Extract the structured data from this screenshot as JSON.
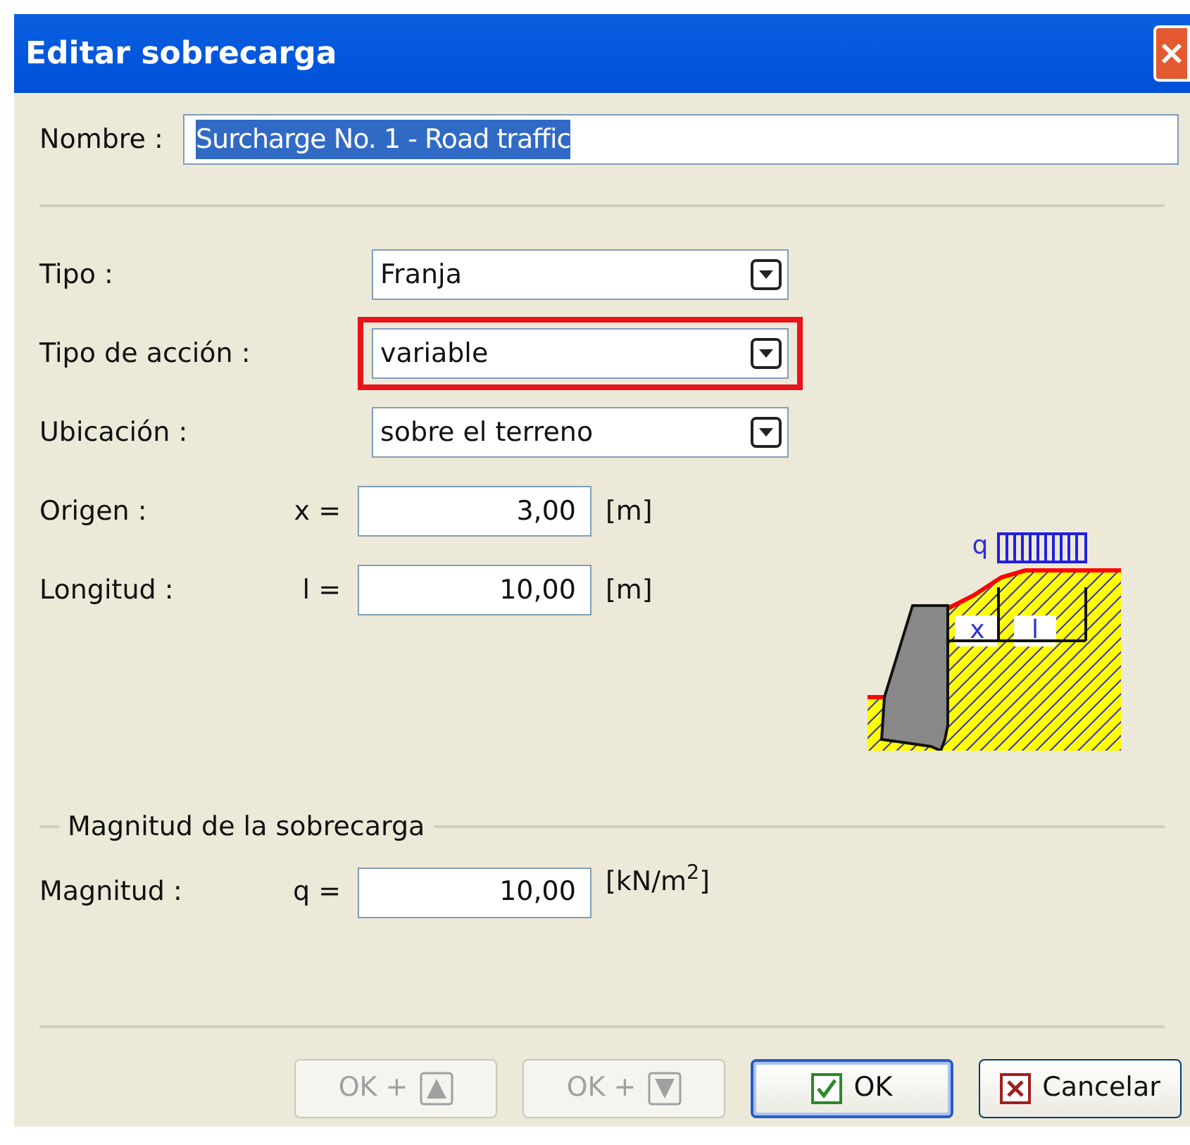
{
  "window": {
    "title": "Editar sobrecarga"
  },
  "name_field": {
    "label": "Nombre :",
    "value": "Surcharge No. 1 - Road traffic",
    "selected_text": true
  },
  "fields": [
    {
      "kind": "dropdown",
      "label": "Tipo :",
      "value": "Franja",
      "highlighted": false
    },
    {
      "kind": "dropdown",
      "label": "Tipo de acción :",
      "value": "variable",
      "highlighted": true
    },
    {
      "kind": "dropdown",
      "label": "Ubicación :",
      "value": "sobre el terreno",
      "highlighted": false
    },
    {
      "kind": "number",
      "label": "Origen :",
      "symbol": "x =",
      "value": "3,00",
      "unit": "[m]"
    },
    {
      "kind": "number",
      "label": "Longitud :",
      "symbol": "l =",
      "value": "10,00",
      "unit": "[m]"
    }
  ],
  "diagram": {
    "labels": [
      "q",
      "x",
      "l"
    ]
  },
  "magnitude_group": {
    "title": "Magnitud de la sobrecarga",
    "label": "Magnitud :",
    "symbol": "q =",
    "value": "10,00",
    "unit": "[kN/m$^{2}$]"
  },
  "buttons": [
    {
      "kind": "up",
      "label": "OK +",
      "disabled": true,
      "default": false
    },
    {
      "kind": "down",
      "label": "OK +",
      "disabled": true,
      "default": false
    },
    {
      "kind": "ok",
      "label": "OK",
      "disabled": false,
      "default": true
    },
    {
      "kind": "cancel",
      "label": "Cancelar",
      "disabled": false,
      "default": false
    }
  ]
}
